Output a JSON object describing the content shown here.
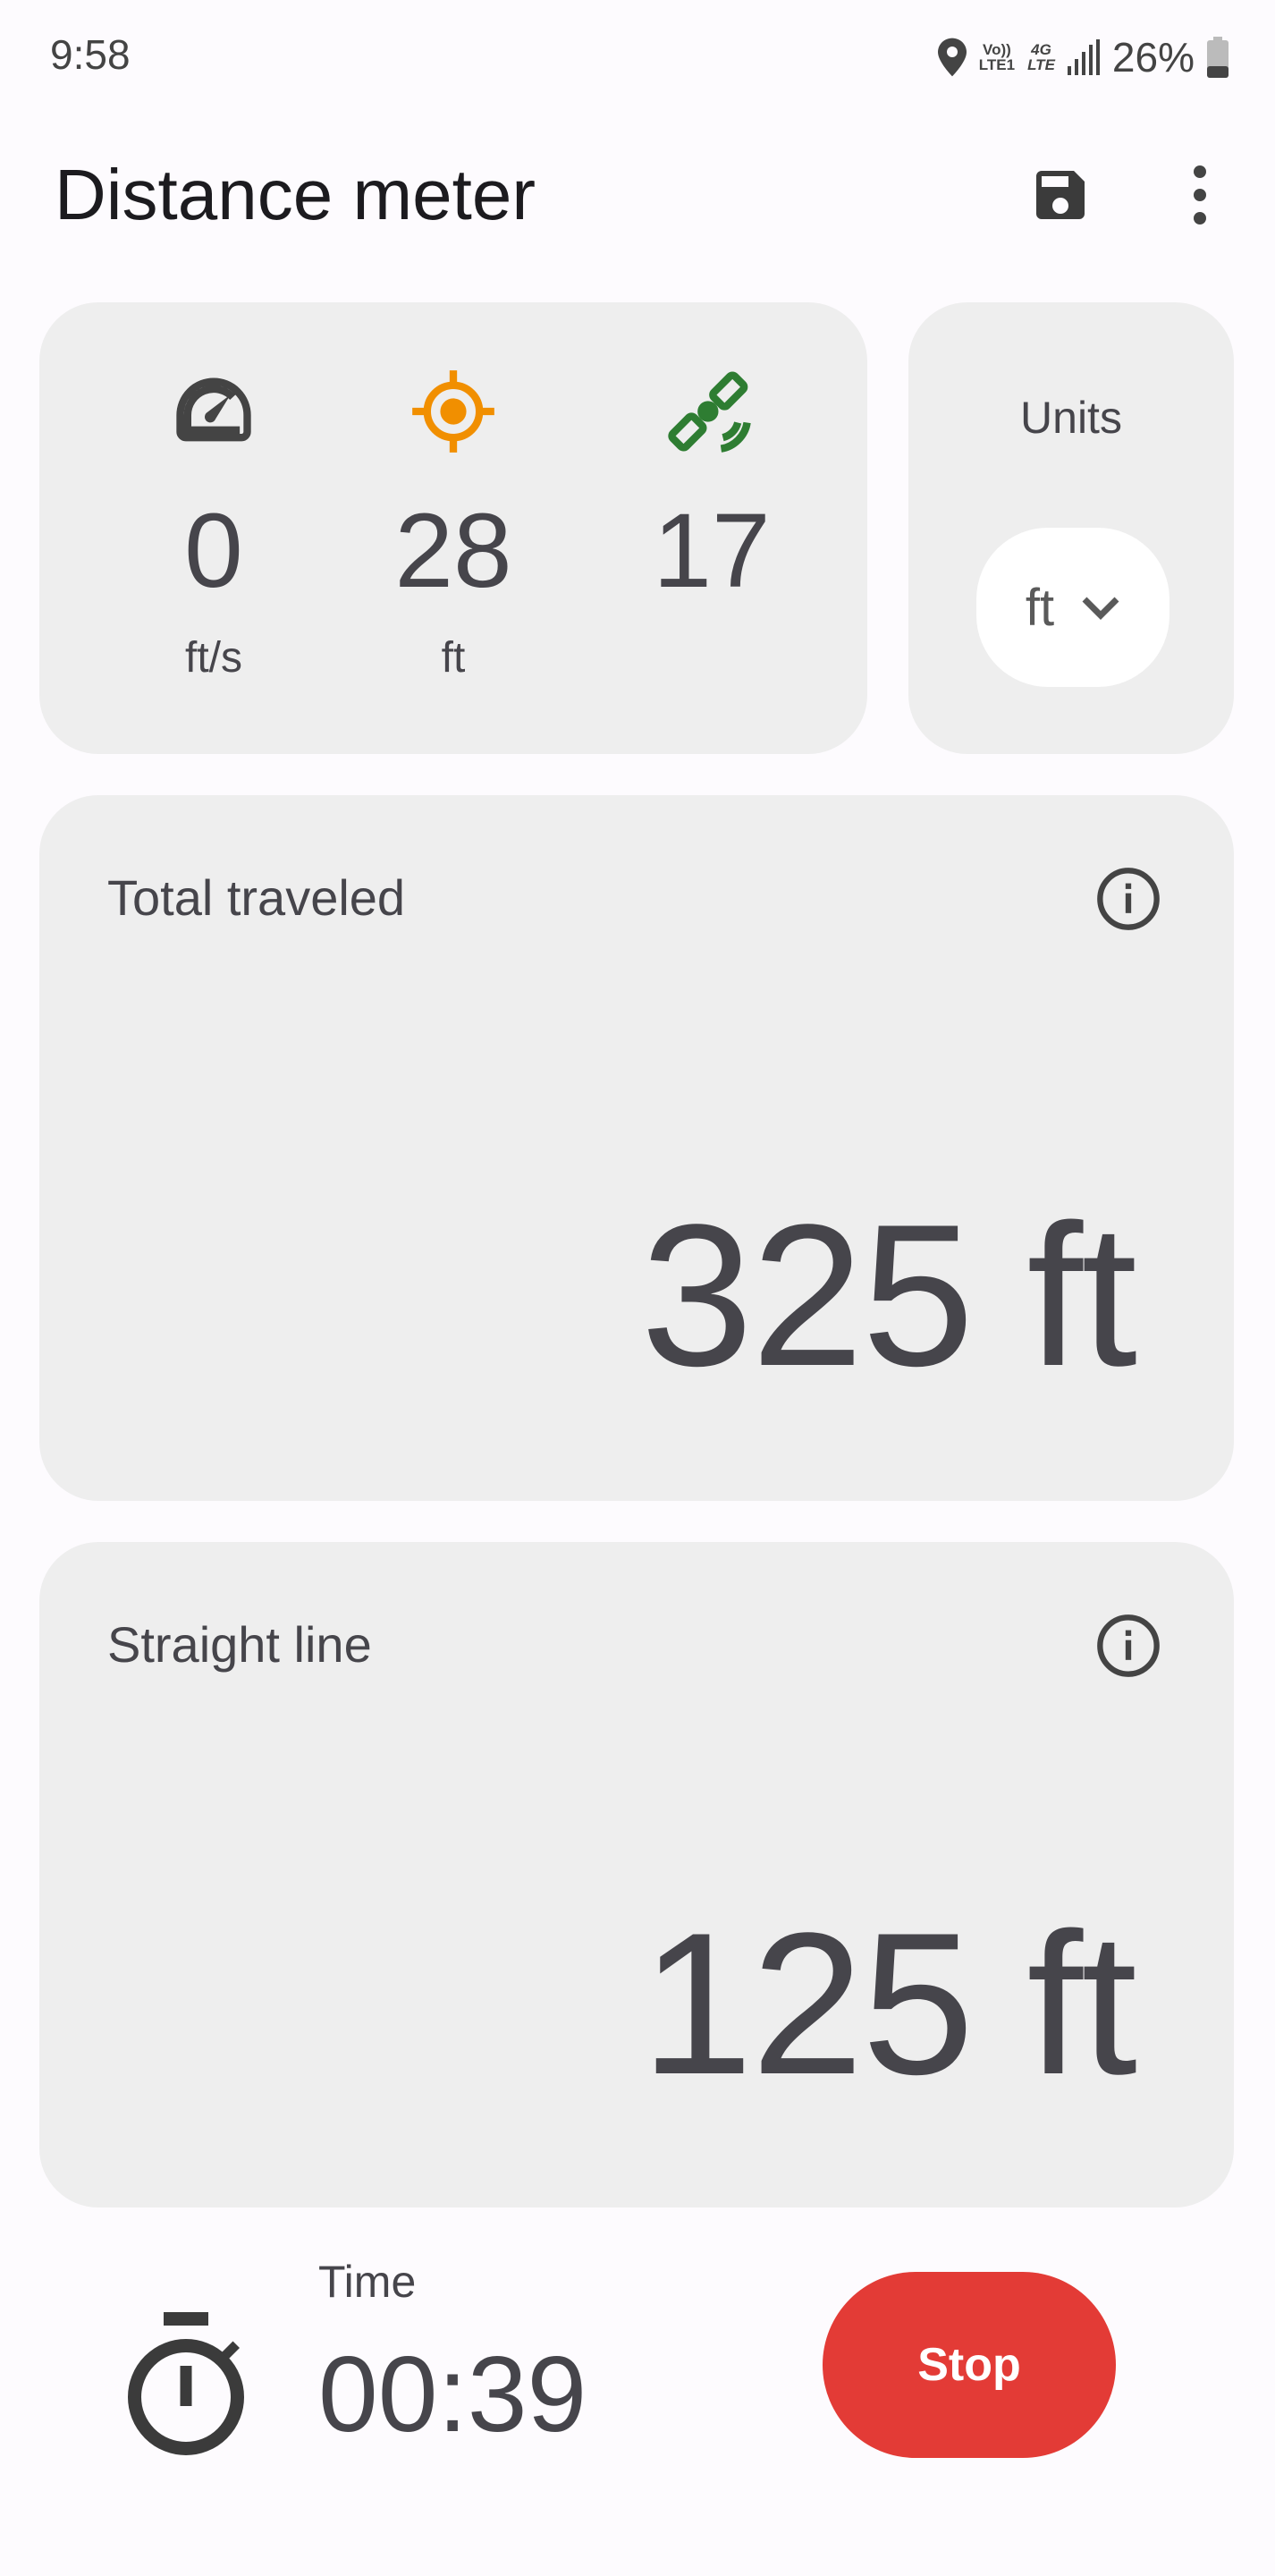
{
  "status_bar": {
    "time": "9:58",
    "volte_top": "Vo))",
    "volte_bottom": "LTE1",
    "net_top": "4G",
    "net_bottom": "LTE",
    "battery": "26%"
  },
  "header": {
    "title": "Distance meter",
    "save_icon": "save-icon",
    "menu_icon": "more-vert-icon"
  },
  "stats": [
    {
      "icon": "speedometer-icon",
      "value": "0",
      "unit": "ft/s",
      "color": "#444444"
    },
    {
      "icon": "gps-accuracy-icon",
      "value": "28",
      "unit": "ft",
      "color": "#f18f00"
    },
    {
      "icon": "satellite-icon",
      "value": "17",
      "unit": "",
      "color": "#2e7d32"
    }
  ],
  "units": {
    "label": "Units",
    "selected": "ft"
  },
  "total_traveled": {
    "label": "Total traveled",
    "value": "325 ft"
  },
  "straight_line": {
    "label": "Straight line",
    "value": "125 ft"
  },
  "timer": {
    "label": "Time",
    "value": "00:39"
  },
  "actions": {
    "stop_label": "Stop",
    "stop_color": "#e33b36"
  }
}
